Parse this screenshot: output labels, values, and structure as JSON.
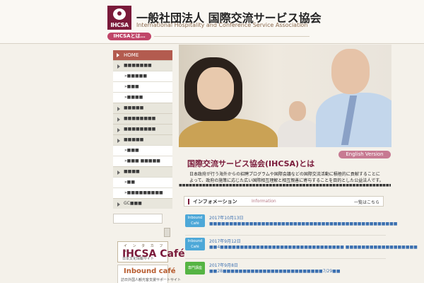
{
  "header": {
    "logo_text": "IHCSA",
    "org_name_ja": "一般社団法人 国際交流サービス協会",
    "org_name_en": "International Hospitality and Conference Service Association",
    "about_label": "IHCSAとは…"
  },
  "sidebar": {
    "home_label": "HOME",
    "items": [
      {
        "type": "cat",
        "label": "■■■■■■■"
      },
      {
        "type": "sub",
        "label": "»■■■■■"
      },
      {
        "type": "sub",
        "label": "»■■■"
      },
      {
        "type": "sub",
        "label": "»■■■■"
      },
      {
        "type": "cat",
        "label": "■■■■■"
      },
      {
        "type": "cat",
        "label": "■■■■■■■■"
      },
      {
        "type": "cat",
        "label": "■■■■■■■■"
      },
      {
        "type": "cat",
        "label": "■■■■■"
      },
      {
        "type": "sub",
        "label": "»■■■"
      },
      {
        "type": "sub",
        "label": "»■■■ ■■■■■"
      },
      {
        "type": "cat",
        "label": "■■■■"
      },
      {
        "type": "sub",
        "label": "»■■"
      },
      {
        "type": "sub",
        "label": "»■■■■■■■■■"
      },
      {
        "type": "cat",
        "label": "GC■■■"
      }
    ],
    "search_placeholder": "",
    "banner_cafe": {
      "small": "イ ン タ カ フ ェ",
      "big": "IHCSA Café",
      "caption": "日本文化情報サイト"
    },
    "banner_inbound": {
      "big": "Inbound café",
      "caption": "訪日外国人観光客支援サポートサイト"
    }
  },
  "main": {
    "english_version_label": "English Version",
    "title": "国際交流サービス協会(IHCSA)とは",
    "intro_lines": [
      "日本政府が行う海外からの招聘プログラムや国際会議などの国際交流活動に積極的に貢献することに",
      "よって、政府の施策に応じた広い国際相互理解と相互親善に寄与することを目的とした公益法人です。"
    ],
    "dots_text": "■■■■■■■■■■■■■■■■■■■■■■■■■■■■■■■■■■■■■■■■■■■■■■■■■■■■■■■■■■■■■■■■■■■■■■■■",
    "info": {
      "title": "インフォメーション",
      "title_en": "Information",
      "more": "一覧はこちら"
    },
    "news": [
      {
        "badge": "Inbound Café",
        "badge_color": "#4da8d8",
        "date": "2017年10月13日",
        "text": "■■■■■■■■■■■■■■■■■■■■■■■■■■■■■■■■■■■■■■■■■■■■■■■"
      },
      {
        "badge": "Inbound Café",
        "badge_color": "#4da8d8",
        "date": "2017年9月12日",
        "text": "■■4■■■■■■■■■■■■■■■■■■■■■■■■■■■■■■■ ■■■■■■■■■■■■■■■■■■"
      },
      {
        "badge": "専門講座",
        "badge_color": "#55b443",
        "date": "2017年9月8日",
        "text": "■■28■■■■■■■■■■■■■■■■■■■■■■■■■7/29■■"
      }
    ]
  }
}
